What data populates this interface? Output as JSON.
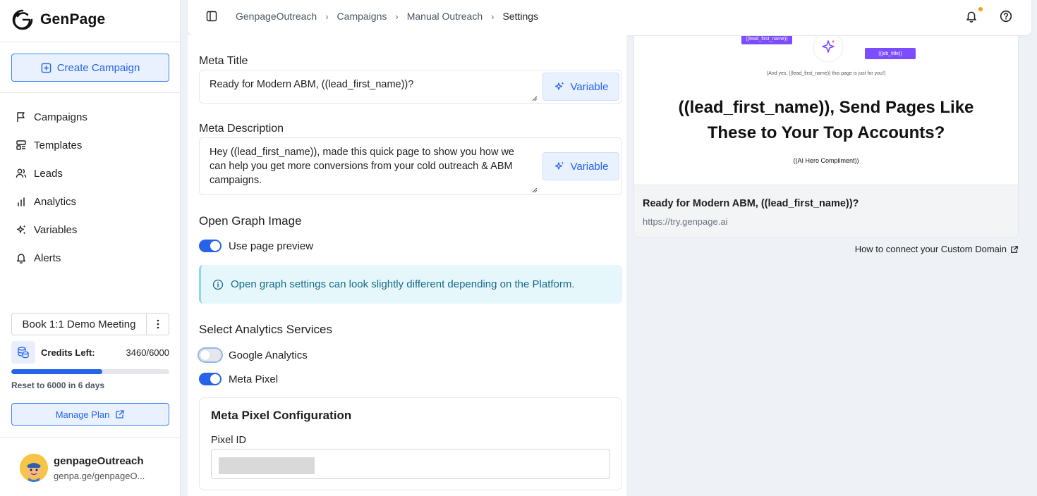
{
  "app": {
    "name": "GenPage"
  },
  "sidebar": {
    "create_label": "Create Campaign",
    "items": [
      {
        "label": "Campaigns",
        "icon": "flag-icon"
      },
      {
        "label": "Templates",
        "icon": "templates-icon"
      },
      {
        "label": "Leads",
        "icon": "users-icon"
      },
      {
        "label": "Analytics",
        "icon": "bar-chart-icon"
      },
      {
        "label": "Variables",
        "icon": "sparkles-icon"
      },
      {
        "label": "Alerts",
        "icon": "bell-icon"
      }
    ],
    "demo_label": "Book 1:1 Demo Meeting",
    "credits_label": "Credits Left:",
    "credits_value": "3460/6000",
    "credits_used_fraction": 0.577,
    "reset_text": "Reset to 6000 in 6 days",
    "manage_label": "Manage Plan",
    "user": {
      "name": "genpageOutreach",
      "url": "genpa.ge/genpageO..."
    }
  },
  "header": {
    "breadcrumb": [
      "GenpageOutreach",
      "Campaigns",
      "Manual Outreach",
      "Settings"
    ]
  },
  "form": {
    "meta_title_label": "Meta Title",
    "meta_title_value": "Ready for Modern ABM, ((lead_first_name))?",
    "variable_label": "Variable",
    "meta_desc_label": "Meta Description",
    "meta_desc_value": "Hey ((lead_first_name)), made this quick page to show you how we can help you get more conversions from your cold outreach & ABM campaigns.",
    "og_title": "Open Graph Image",
    "use_preview_label": "Use page preview",
    "use_preview_on": true,
    "info_text": "Open graph settings can look slightly different depending on the Platform.",
    "analytics_title": "Select Analytics Services",
    "google_label": "Google Analytics",
    "google_on": false,
    "meta_pixel_label": "Meta Pixel",
    "meta_pixel_on": true,
    "meta_config_title": "Meta Pixel Configuration",
    "pixel_id_label": "Pixel ID"
  },
  "preview": {
    "chip_left": "((lead_first_name))",
    "chip_right": "((job_title))",
    "note": "(And yes, ((lead_first_name)) this page is just for you!)",
    "headline_line1": "((lead_first_name)), Send Pages Like",
    "headline_line2": "These to Your Top Accounts?",
    "sub": "((AI Hero Compliment))",
    "meta_title": "Ready for Modern ABM, ((lead_first_name))?",
    "url": "https://try.genpage.ai",
    "domain_link": "How to connect your Custom Domain"
  },
  "colors": {
    "accent": "#2563eb",
    "chip": "#7c4dff",
    "info_bg": "#e6f7fb",
    "notif_dot": "#f59e0b"
  }
}
